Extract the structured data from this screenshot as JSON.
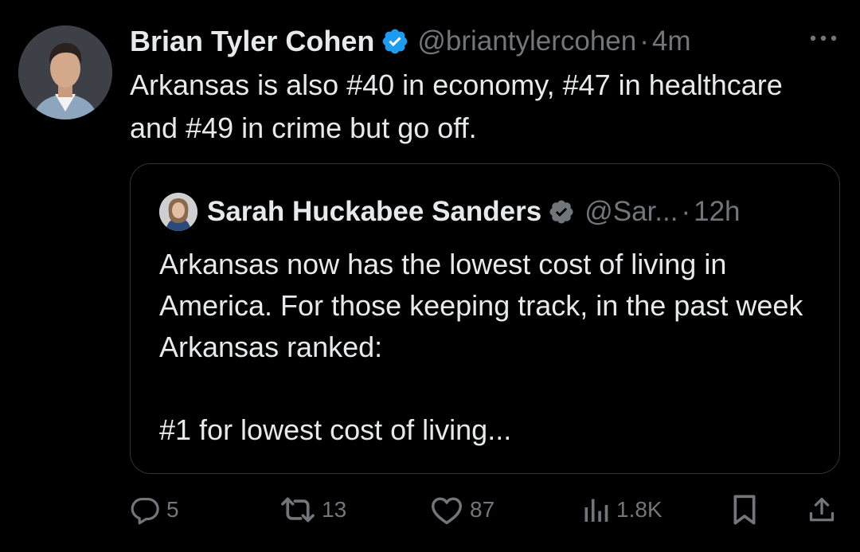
{
  "tweet": {
    "author_name": "Brian Tyler Cohen",
    "handle": "@briantylercohen",
    "separator": "·",
    "time": "4m",
    "text": "Arkansas is also #40 in economy, #47 in healthcare and #49 in crime but go off."
  },
  "quote": {
    "author_name": "Sarah Huckabee Sanders",
    "handle": "@Sar...",
    "separator": "·",
    "time": "12h",
    "text_line1": "Arkansas now has the lowest cost of living in America. For those keeping track, in the past week Arkansas ranked:",
    "text_line2": "#1 for lowest cost of living..."
  },
  "actions": {
    "replies": "5",
    "reposts": "13",
    "likes": "87",
    "views": "1.8K"
  },
  "icons": {
    "verified": "verified-badge-icon",
    "more": "more-icon",
    "reply": "reply-icon",
    "repost": "repost-icon",
    "like": "like-icon",
    "views": "views-icon",
    "bookmark": "bookmark-icon",
    "share": "share-icon"
  },
  "colors": {
    "background": "#000000",
    "text": "#e7e9ea",
    "secondary": "#71767b",
    "verified": "#1d9bf0",
    "border": "#2f3336"
  }
}
